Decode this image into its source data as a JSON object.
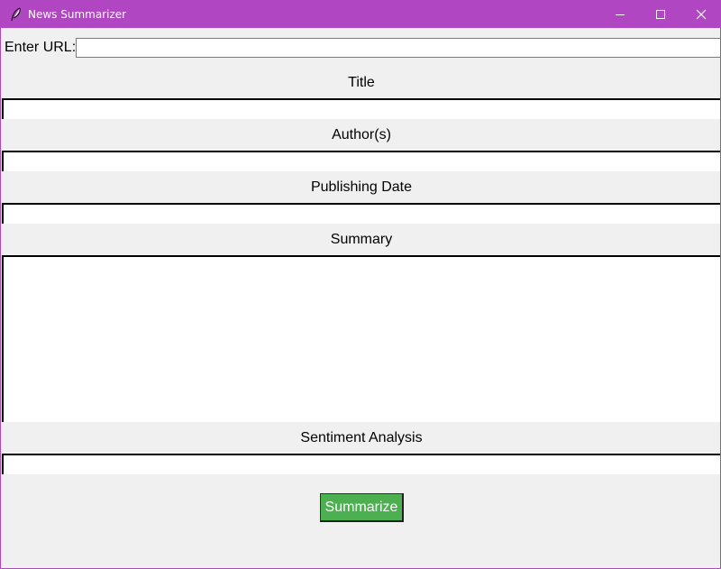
{
  "window": {
    "title": "News Summarizer",
    "app_icon": "feather-icon",
    "titlebar_color": "#b146c2",
    "controls": {
      "minimize_icon": "minimize-icon",
      "maximize_icon": "maximize-icon",
      "close_icon": "close-icon"
    }
  },
  "url": {
    "label": "Enter URL:",
    "value": ""
  },
  "sections": {
    "title": {
      "label": "Title",
      "value": ""
    },
    "authors": {
      "label": "Author(s)",
      "value": ""
    },
    "publishing_date": {
      "label": "Publishing Date",
      "value": ""
    },
    "summary": {
      "label": "Summary",
      "value": ""
    },
    "sentiment": {
      "label": "Sentiment Analysis",
      "value": ""
    }
  },
  "actions": {
    "summarize_label": "Summarize",
    "summarize_color": "#4caf50"
  }
}
